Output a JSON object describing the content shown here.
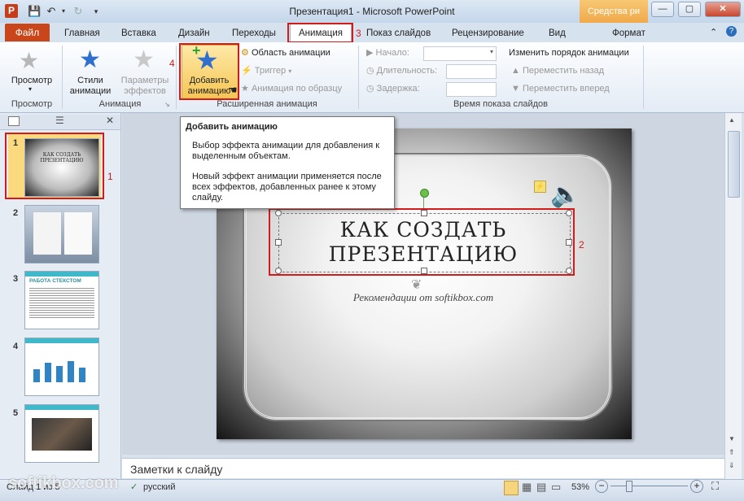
{
  "window": {
    "title": "Презентация1 - Microsoft PowerPoint",
    "context_tab_header": "Средства ри",
    "app_icon": "P"
  },
  "tabs": {
    "file": "Файл",
    "items": [
      "Главная",
      "Вставка",
      "Дизайн",
      "Переходы",
      "Анимация",
      "Показ слайдов",
      "Рецензирование",
      "Вид",
      "Формат"
    ]
  },
  "ribbon": {
    "preview_label": "Просмотр",
    "anim_styles_label": "Стили анимации",
    "effect_params_label": "Параметры эффектов",
    "add_anim_label": "Добавить анимацию",
    "anim_pane": "Область анимации",
    "trigger": "Триггер",
    "anim_painter": "Анимация по образцу",
    "start_label": "Начало:",
    "duration_label": "Длительность:",
    "delay_label": "Задержка:",
    "reorder_title": "Изменить порядок анимации",
    "move_back": "Переместить назад",
    "move_forward": "Переместить вперед",
    "groups": {
      "preview": "Просмотр",
      "animation": "Анимация",
      "advanced": "Расширенная анимация",
      "timing": "Время показа слайдов"
    }
  },
  "tooltip": {
    "title": "Добавить анимацию",
    "line1": "Выбор эффекта анимации для добавления к выделенным объектам.",
    "line2": "Новый эффект анимации применяется после всех эффектов, добавленных ранее к этому слайду."
  },
  "slides": {
    "numbers": [
      "1",
      "2",
      "3",
      "4",
      "5"
    ],
    "thumb1_title": "КАК СОЗДАТЬ ПРЕЗЕНТАЦИЮ",
    "thumb3_title": "РАБОТА СТЕКСТОМ"
  },
  "slide": {
    "title_line1": "КАК СОЗДАТЬ",
    "title_line2": "ПРЕЗЕНТАЦИЮ",
    "subtitle": "Рекомендации от softikbox.com"
  },
  "notes_placeholder": "Заметки к слайду",
  "status": {
    "slide_info": "Слайд 1 из 5",
    "language": "русский",
    "zoom": "53%",
    "watermark": "softikbox.com"
  },
  "annotations": [
    "1",
    "2",
    "3",
    "4"
  ],
  "colors": {
    "file_tab": "#c9461b",
    "highlight_red": "#d41b1b",
    "selected_thumb": "#fbd97f"
  }
}
